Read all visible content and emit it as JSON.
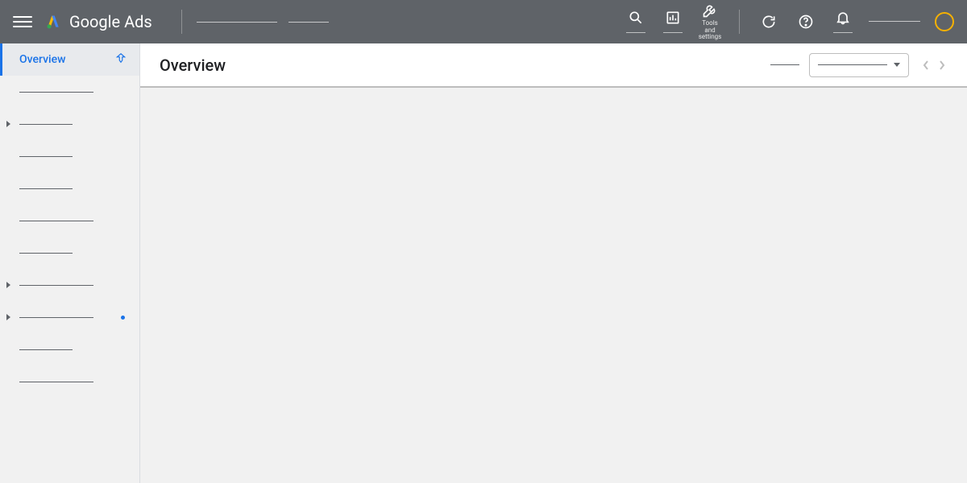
{
  "header": {
    "brand": "Google Ads",
    "tools_label_line1": "Tools",
    "tools_label_line2": "and settings"
  },
  "sidebar": {
    "items": [
      {
        "label": "Overview",
        "active": true,
        "pinned": true
      },
      {
        "label": "",
        "active": false
      },
      {
        "label": "",
        "active": false,
        "caret": true
      },
      {
        "label": "",
        "active": false
      },
      {
        "label": "",
        "active": false
      },
      {
        "label": "",
        "active": false,
        "long": true
      },
      {
        "label": "",
        "active": false
      },
      {
        "label": "",
        "active": false,
        "caret": true,
        "long": true
      },
      {
        "label": "",
        "active": false,
        "caret": true,
        "dot": true,
        "long": true
      },
      {
        "label": "",
        "active": false
      },
      {
        "label": "",
        "active": false,
        "long": true
      }
    ]
  },
  "main": {
    "title": "Overview"
  }
}
